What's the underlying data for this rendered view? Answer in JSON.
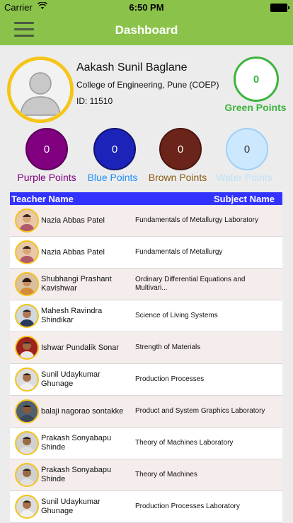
{
  "status_bar": {
    "carrier": "Carrier",
    "wifi_icon": "wifi-icon",
    "time": "6:50 PM",
    "battery_icon": "battery-icon"
  },
  "nav": {
    "title": "Dashboard",
    "menu_icon": "hamburger-menu-icon"
  },
  "profile": {
    "name": "Aakash Sunil Baglane",
    "college": "College of Engineering, Pune (COEP)",
    "id": "ID: 11510",
    "avatar_icon": "user-placeholder-icon"
  },
  "points": {
    "green": {
      "value": "0",
      "label": "Green Points",
      "color": "#3cb43c"
    },
    "purple": {
      "value": "0",
      "label": "Purple Points",
      "color": "#800080"
    },
    "blue": {
      "value": "0",
      "label": "Blue Points",
      "color": "#1c23b8"
    },
    "brown": {
      "value": "0",
      "label": "Brown Points",
      "color": "#6b2419"
    },
    "water": {
      "value": "0",
      "label": "Water Points",
      "color": "#cce8ff"
    }
  },
  "table": {
    "header": {
      "teacher": "Teacher Name",
      "subject": "Subject Name"
    },
    "rows": [
      {
        "teacher": "Nazia Abbas Patel",
        "subject": "Fundamentals of Metallurgy Laboratory"
      },
      {
        "teacher": "Nazia Abbas Patel",
        "subject": "Fundamentals of Metallurgy"
      },
      {
        "teacher": "Shubhangi Prashant Kavishwar",
        "subject": "Ordinary Differential Equations and Multivari..."
      },
      {
        "teacher": "Mahesh Ravindra Shindikar",
        "subject": "Science of Living Systems"
      },
      {
        "teacher": "Ishwar Pundalik Sonar",
        "subject": "Strength of Materials"
      },
      {
        "teacher": "Sunil Udaykumar Ghunage",
        "subject": "Production Processes"
      },
      {
        "teacher": "balaji nagorao sontakke",
        "subject": "Product and System Graphics Laboratory"
      },
      {
        "teacher": "Prakash Sonyabapu Shinde",
        "subject": "Theory of Machines Laboratory"
      },
      {
        "teacher": "Prakash Sonyabapu Shinde",
        "subject": "Theory of Machines"
      },
      {
        "teacher": "Sunil Udaykumar Ghunage",
        "subject": "Production Processes Laboratory"
      }
    ]
  }
}
